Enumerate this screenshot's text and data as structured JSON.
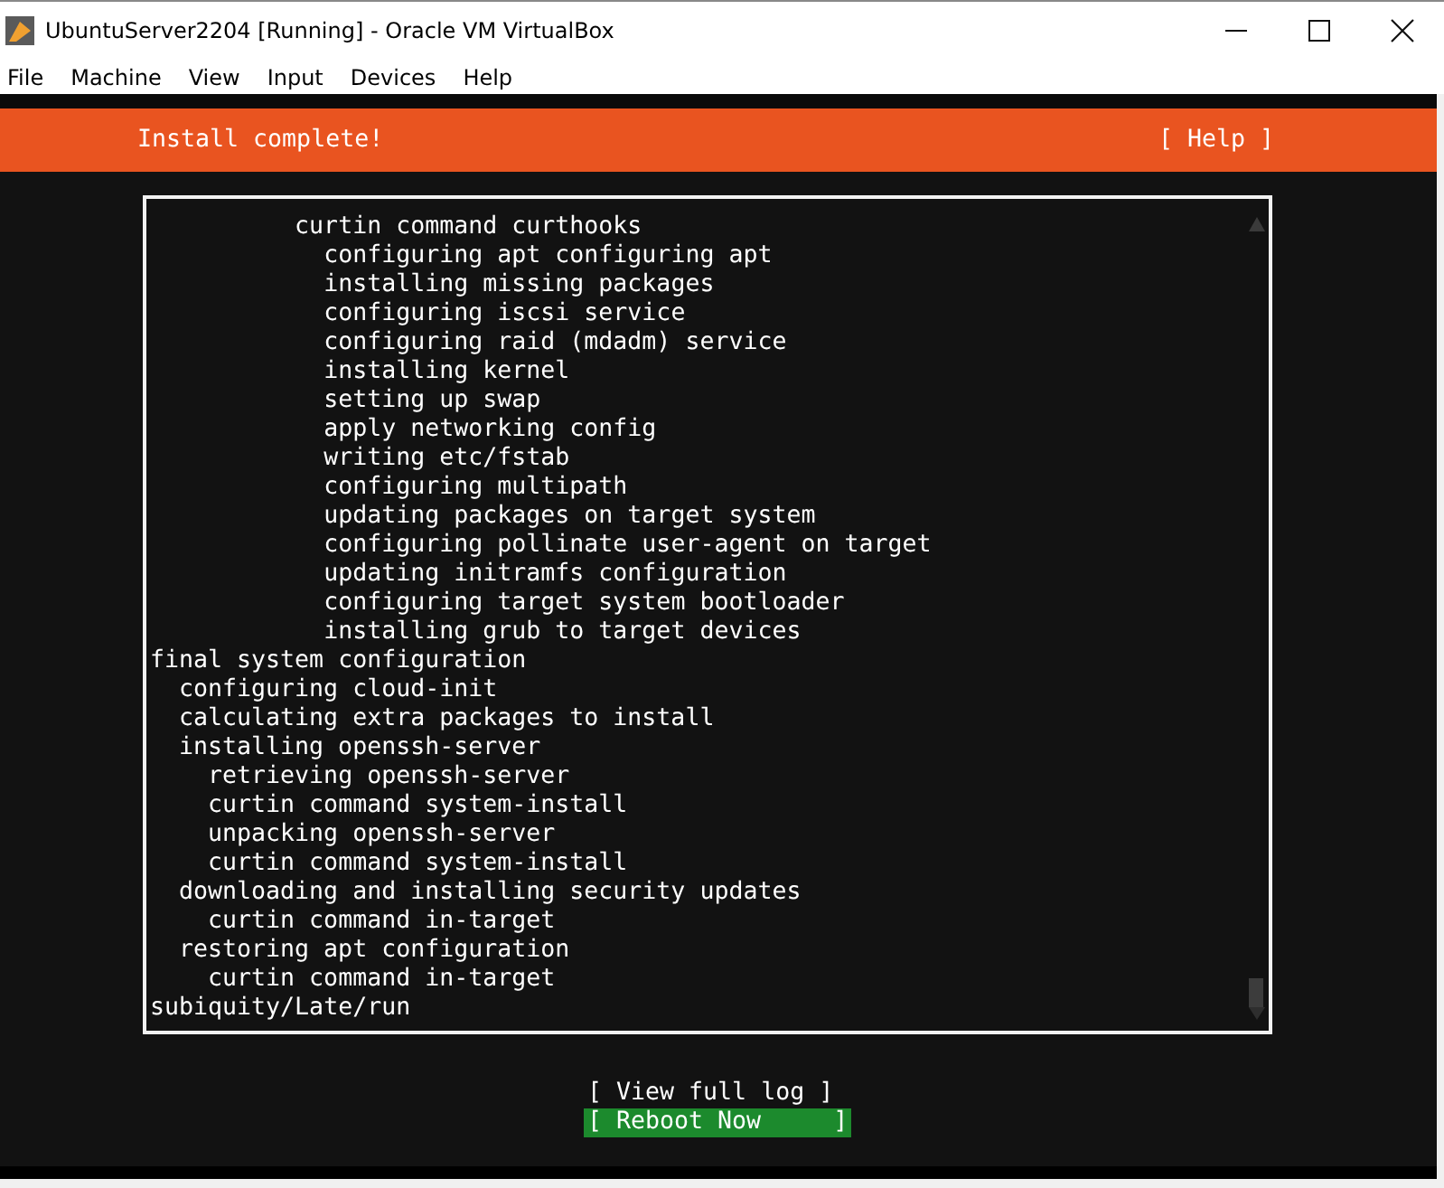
{
  "window": {
    "title": "UbuntuServer2204 [Running] - Oracle VM VirtualBox"
  },
  "menu": [
    "File",
    "Machine",
    "View",
    "Input",
    "Devices",
    "Help"
  ],
  "header": {
    "title": "Install complete!",
    "help": "[ Help ]"
  },
  "log": [
    {
      "children": [
        {
          "children": [
            {
              "children": [
                {
                  "children": [
                    {
                      "children": [
                        {
                          "text": "curtin command curthooks",
                          "children": [
                            {
                              "text": "configuring apt configuring apt"
                            },
                            {
                              "text": "installing missing packages"
                            },
                            {
                              "text": "configuring iscsi service"
                            },
                            {
                              "text": "configuring raid (mdadm) service"
                            },
                            {
                              "text": "installing kernel"
                            },
                            {
                              "text": "setting up swap"
                            },
                            {
                              "text": "apply networking config"
                            },
                            {
                              "text": "writing etc/fstab"
                            },
                            {
                              "text": "configuring multipath"
                            },
                            {
                              "text": "updating packages on target system"
                            },
                            {
                              "text": "configuring pollinate user-agent on target"
                            },
                            {
                              "text": "updating initramfs configuration"
                            },
                            {
                              "text": "configuring target system bootloader"
                            },
                            {
                              "text": "installing grub to target devices"
                            }
                          ]
                        }
                      ]
                    }
                  ]
                }
              ]
            }
          ]
        }
      ]
    },
    {
      "text": "final system configuration",
      "children": [
        {
          "text": "configuring cloud-init"
        },
        {
          "text": "calculating extra packages to install"
        },
        {
          "text": "installing openssh-server",
          "children": [
            {
              "text": "retrieving openssh-server"
            },
            {
              "text": "curtin command system-install"
            },
            {
              "text": "unpacking openssh-server"
            },
            {
              "text": "curtin command system-install"
            }
          ]
        },
        {
          "text": "downloading and installing security updates",
          "children": [
            {
              "text": "curtin command in-target"
            }
          ]
        },
        {
          "text": "restoring apt configuration",
          "children": [
            {
              "text": "curtin command in-target"
            }
          ]
        }
      ]
    },
    {
      "text": "subiquity/Late/run"
    }
  ],
  "buttons": [
    {
      "label": "[ View full log ]",
      "selected": false
    },
    {
      "label": "[ Reboot Now     ]",
      "selected": true
    }
  ]
}
